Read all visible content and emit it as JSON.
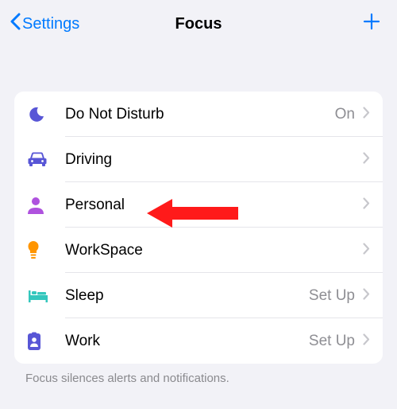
{
  "header": {
    "back_label": "Settings",
    "title": "Focus"
  },
  "rows": [
    {
      "icon": "moon",
      "label": "Do Not Disturb",
      "status": "On",
      "color": "#5856d6"
    },
    {
      "icon": "car",
      "label": "Driving",
      "status": "",
      "color": "#5856d6"
    },
    {
      "icon": "person",
      "label": "Personal",
      "status": "",
      "color": "#af52de"
    },
    {
      "icon": "bulb",
      "label": "WorkSpace",
      "status": "",
      "color": "#ff9500"
    },
    {
      "icon": "bed",
      "label": "Sleep",
      "status": "Set Up",
      "color": "#30d0c3"
    },
    {
      "icon": "badge",
      "label": "Work",
      "status": "Set Up",
      "color": "#5856d6"
    }
  ],
  "footer": "Focus silences alerts and notifications."
}
